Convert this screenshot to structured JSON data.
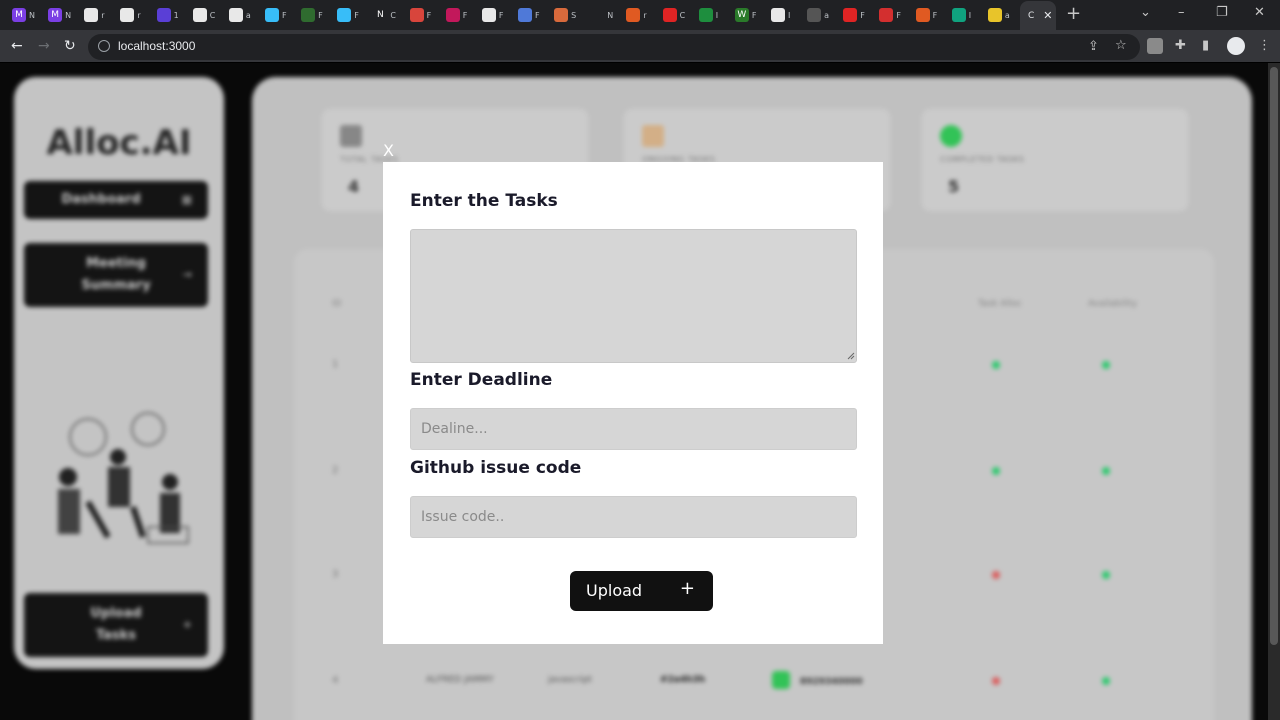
{
  "browser": {
    "url": "localhost:3000",
    "tabs": [
      {
        "glyph": "M",
        "text": "N",
        "color": "#7b3fe4"
      },
      {
        "glyph": "M",
        "text": "N",
        "color": "#7b3fe4"
      },
      {
        "glyph": "",
        "text": "r",
        "color": "#e8e8e8"
      },
      {
        "glyph": "",
        "text": "r",
        "color": "#e8e8e8"
      },
      {
        "glyph": "",
        "text": "1",
        "color": "#5a3fd6"
      },
      {
        "glyph": "",
        "text": "C",
        "color": "#e8e8e8"
      },
      {
        "glyph": "",
        "text": "a",
        "color": "#e8e8e8"
      },
      {
        "glyph": "",
        "text": "F",
        "color": "#38bdf8"
      },
      {
        "glyph": "",
        "text": "F",
        "color": "#2f6b2f"
      },
      {
        "glyph": "",
        "text": "F",
        "color": "#38bdf8"
      },
      {
        "glyph": "N",
        "text": "C",
        "color": "#202124"
      },
      {
        "glyph": "",
        "text": "F",
        "color": "#d8453c"
      },
      {
        "glyph": "",
        "text": "F",
        "color": "#c2185b"
      },
      {
        "glyph": "",
        "text": "F",
        "color": "#e8e8e8"
      },
      {
        "glyph": "",
        "text": "F",
        "color": "#4f79d8"
      },
      {
        "glyph": "",
        "text": "S",
        "color": "#d86a3c"
      },
      {
        "glyph": "",
        "text": "N",
        "color": "#202124"
      },
      {
        "glyph": "",
        "text": "r",
        "color": "#e05a22"
      },
      {
        "glyph": "",
        "text": "C",
        "color": "#e02424"
      },
      {
        "glyph": "",
        "text": "I",
        "color": "#1e8e3e"
      },
      {
        "glyph": "W",
        "text": "F",
        "color": "#2a7a2a"
      },
      {
        "glyph": "",
        "text": "I",
        "color": "#e8e8e8"
      },
      {
        "glyph": "",
        "text": "a",
        "color": "#555555"
      },
      {
        "glyph": "",
        "text": "F",
        "color": "#e02424"
      },
      {
        "glyph": "",
        "text": "F",
        "color": "#d32f2f"
      },
      {
        "glyph": "",
        "text": "F",
        "color": "#e05a22"
      },
      {
        "glyph": "",
        "text": "I",
        "color": "#10a37f"
      },
      {
        "glyph": "",
        "text": "a",
        "color": "#e8c42a"
      }
    ],
    "active_tab": {
      "text": "C"
    }
  },
  "app": {
    "logo": "Alloc.AI",
    "sidebar": {
      "dashboard": "Dashboard",
      "meeting_summary": "Meeting Summary",
      "upload_tasks": "Upload Tasks"
    },
    "stats": [
      {
        "label": "TOTAL TASKS",
        "value": "4",
        "color": "#8a8a8a"
      },
      {
        "label": "ONGOING TASKS",
        "value": "",
        "color": "#d8b38a"
      },
      {
        "label": "COMPLETED TASKS",
        "value": "5",
        "color": "#34c759"
      }
    ],
    "table": {
      "headers": [
        "ID",
        "Task Alloc",
        "Availability"
      ],
      "rows": [
        {
          "id": "1",
          "alloc": "#2ecc71",
          "avail": "#2ecc71"
        },
        {
          "id": "2",
          "alloc": "#2ecc71",
          "avail": "#2ecc71"
        },
        {
          "id": "3",
          "alloc": "#e06060",
          "avail": "#2ecc71"
        },
        {
          "id": "4",
          "alloc": "#e06060",
          "avail": "#2ecc71",
          "name": "ALFRED JAMMY",
          "lang": "javascript",
          "code": "#2a4h3h",
          "badge": "8929340000"
        }
      ]
    }
  },
  "modal": {
    "close": "X",
    "tasks_label": "Enter the Tasks",
    "tasks_value": "",
    "deadline_label": "Enter Deadline",
    "deadline_placeholder": "Dealine...",
    "issue_label": "Github issue code",
    "issue_placeholder": "Issue code..",
    "upload_label": "Upload",
    "upload_icon": "+"
  }
}
